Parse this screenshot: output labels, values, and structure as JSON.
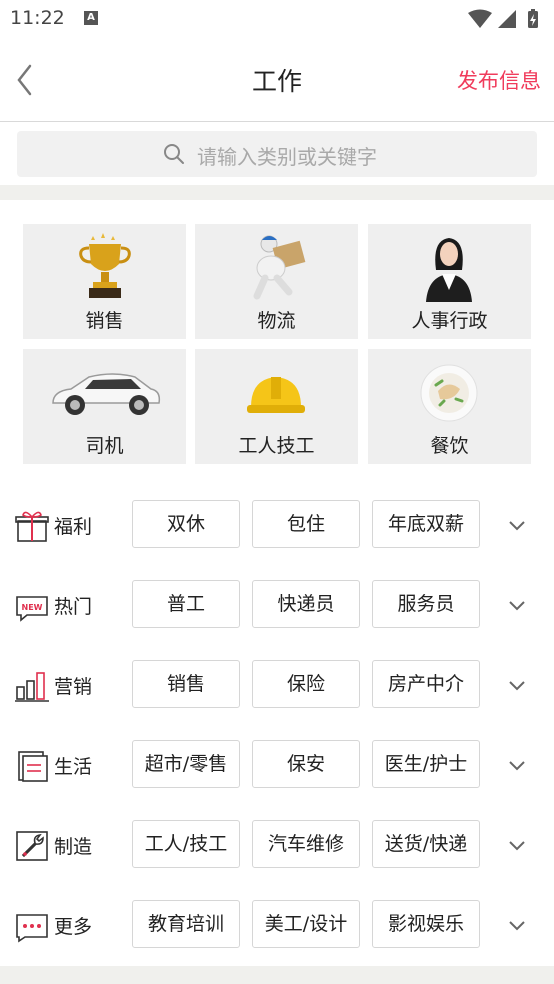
{
  "status_bar": {
    "time": "11:22",
    "notification_letter": "A"
  },
  "header": {
    "title": "工作",
    "publish_label": "发布信息"
  },
  "search": {
    "placeholder": "请输入类别或关键字"
  },
  "categories": [
    {
      "label": "销售",
      "icon": "trophy-icon"
    },
    {
      "label": "物流",
      "icon": "delivery-man-icon"
    },
    {
      "label": "人事行政",
      "icon": "office-woman-icon"
    },
    {
      "label": "司机",
      "icon": "white-car-icon"
    },
    {
      "label": "工人技工",
      "icon": "hard-hat-icon"
    },
    {
      "label": "餐饮",
      "icon": "food-plate-icon"
    }
  ],
  "tag_rows": [
    {
      "label": "福利",
      "icon": "gift-icon",
      "tags": [
        "双休",
        "包住",
        "年底双薪"
      ]
    },
    {
      "label": "热门",
      "icon": "new-badge-icon",
      "tags": [
        "普工",
        "快递员",
        "服务员"
      ]
    },
    {
      "label": "营销",
      "icon": "bar-chart-icon",
      "tags": [
        "销售",
        "保险",
        "房产中介"
      ]
    },
    {
      "label": "生活",
      "icon": "document-icon",
      "tags": [
        "超市/零售",
        "保安",
        "医生/护士"
      ]
    },
    {
      "label": "制造",
      "icon": "wrench-icon",
      "tags": [
        "工人/技工",
        "汽车维修",
        "送货/快递"
      ]
    },
    {
      "label": "更多",
      "icon": "more-dots-icon",
      "tags": [
        "教育培训",
        "美工/设计",
        "影视娱乐"
      ]
    }
  ],
  "colors": {
    "accent": "#f03c5c",
    "tile_bg": "#efefef",
    "band": "#f0f0ed"
  }
}
